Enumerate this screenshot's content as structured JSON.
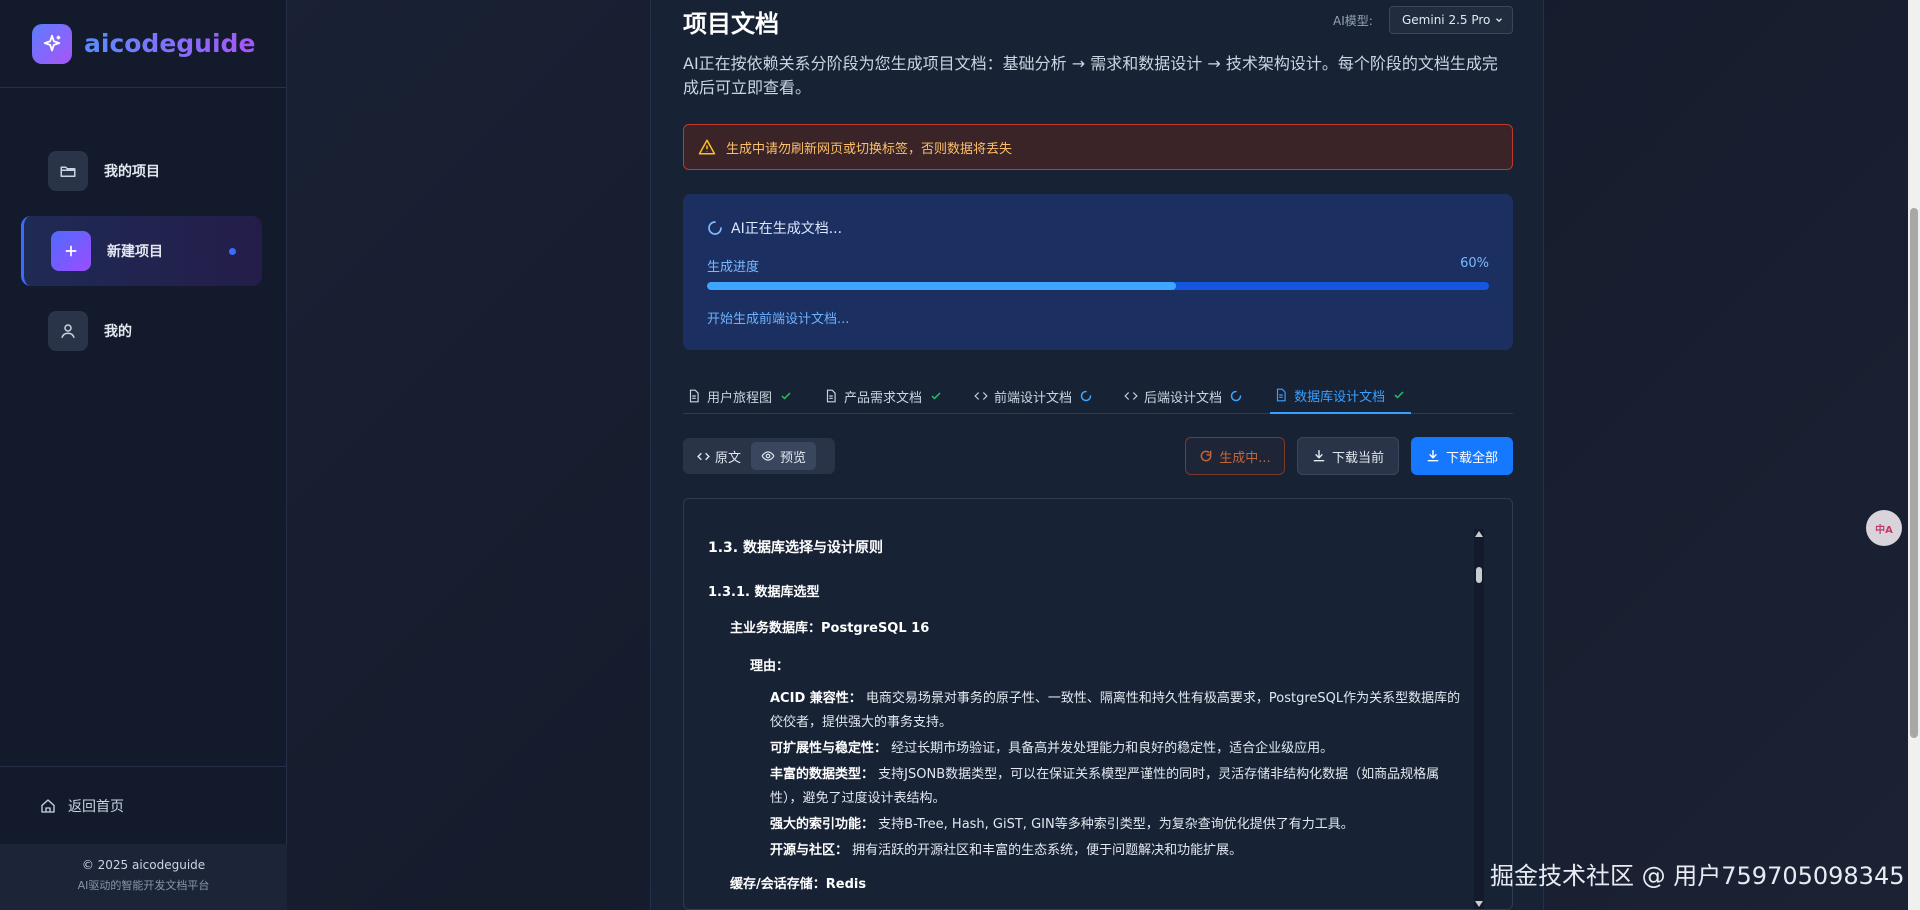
{
  "app": {
    "name": "aicodeguide"
  },
  "sidebar": {
    "items": [
      {
        "label": "我的项目",
        "icon": "folder-open-icon"
      },
      {
        "label": "新建项目",
        "icon": "plus-icon",
        "active": true
      },
      {
        "label": "我的",
        "icon": "user-icon"
      }
    ],
    "back_home": "返回首页",
    "copyright": "© 2025 aicodeguide",
    "tagline": "AI驱动的智能开发文档平台"
  },
  "header": {
    "title": "项目文档",
    "model_label": "AI模型:",
    "model_value": "Gemini 2.5 Pro",
    "subtitle": "AI正在按依赖关系分阶段为您生成项目文档：基础分析 → 需求和数据设计 → 技术架构设计。每个阶段的文档生成完成后可立即查看。"
  },
  "warning": {
    "text": "生成中请勿刷新网页或切换标签，否则数据将丢失",
    "color": "#fbbf6a"
  },
  "progress": {
    "status": "AI正在生成文档...",
    "label": "生成进度",
    "percent_text": "60%",
    "percent": 60,
    "message": "开始生成前端设计文档..."
  },
  "tabs": [
    {
      "label": "用户旅程图",
      "state": "done"
    },
    {
      "label": "产品需求文档",
      "state": "done"
    },
    {
      "label": "前端设计文档",
      "state": "loading"
    },
    {
      "label": "后端设计文档",
      "state": "loading"
    },
    {
      "label": "数据库设计文档",
      "state": "done",
      "active": true
    }
  ],
  "toolbar": {
    "raw_label": "原文",
    "preview_label": "预览",
    "generating_label": "生成中...",
    "download_current_label": "下载当前",
    "download_all_label": "下载全部"
  },
  "doc": {
    "h3": "1.3. 数据库选择与设计原则",
    "h4": "1.3.1. 数据库选型",
    "main_db": "主业务数据库：PostgreSQL 16",
    "reason": "理由：",
    "bullets": [
      {
        "title": "ACID 兼容性：",
        "text": " 电商交易场景对事务的原子性、一致性、隔离性和持久性有极高要求，PostgreSQL作为关系型数据库的佼佼者，提供强大的事务支持。"
      },
      {
        "title": "可扩展性与稳定性：",
        "text": " 经过长期市场验证，具备高并发处理能力和良好的稳定性，适合企业级应用。"
      },
      {
        "title": "丰富的数据类型：",
        "text": " 支持JSONB数据类型，可以在保证关系模型严谨性的同时，灵活存储非结构化数据（如商品规格属性），避免了过度设计表结构。"
      },
      {
        "title": "强大的索引功能：",
        "text": " 支持B-Tree, Hash, GiST, GIN等多种索引类型，为复杂查询优化提供了有力工具。"
      },
      {
        "title": "开源与社区：",
        "text": " 拥有活跃的开源社区和丰富的生态系统，便于问题解决和功能扩展。"
      }
    ],
    "cache": "缓存/会话存储：Redis"
  },
  "float_button": {
    "text": "中A",
    "icon": "translate-icon"
  },
  "watermark": "掘金技术社区 @ 用户759705098345",
  "colors": {
    "accent": "#1677ff",
    "progress_fill": "#3ea6ff",
    "success": "#22c55e",
    "warning_border": "#c0392b"
  }
}
